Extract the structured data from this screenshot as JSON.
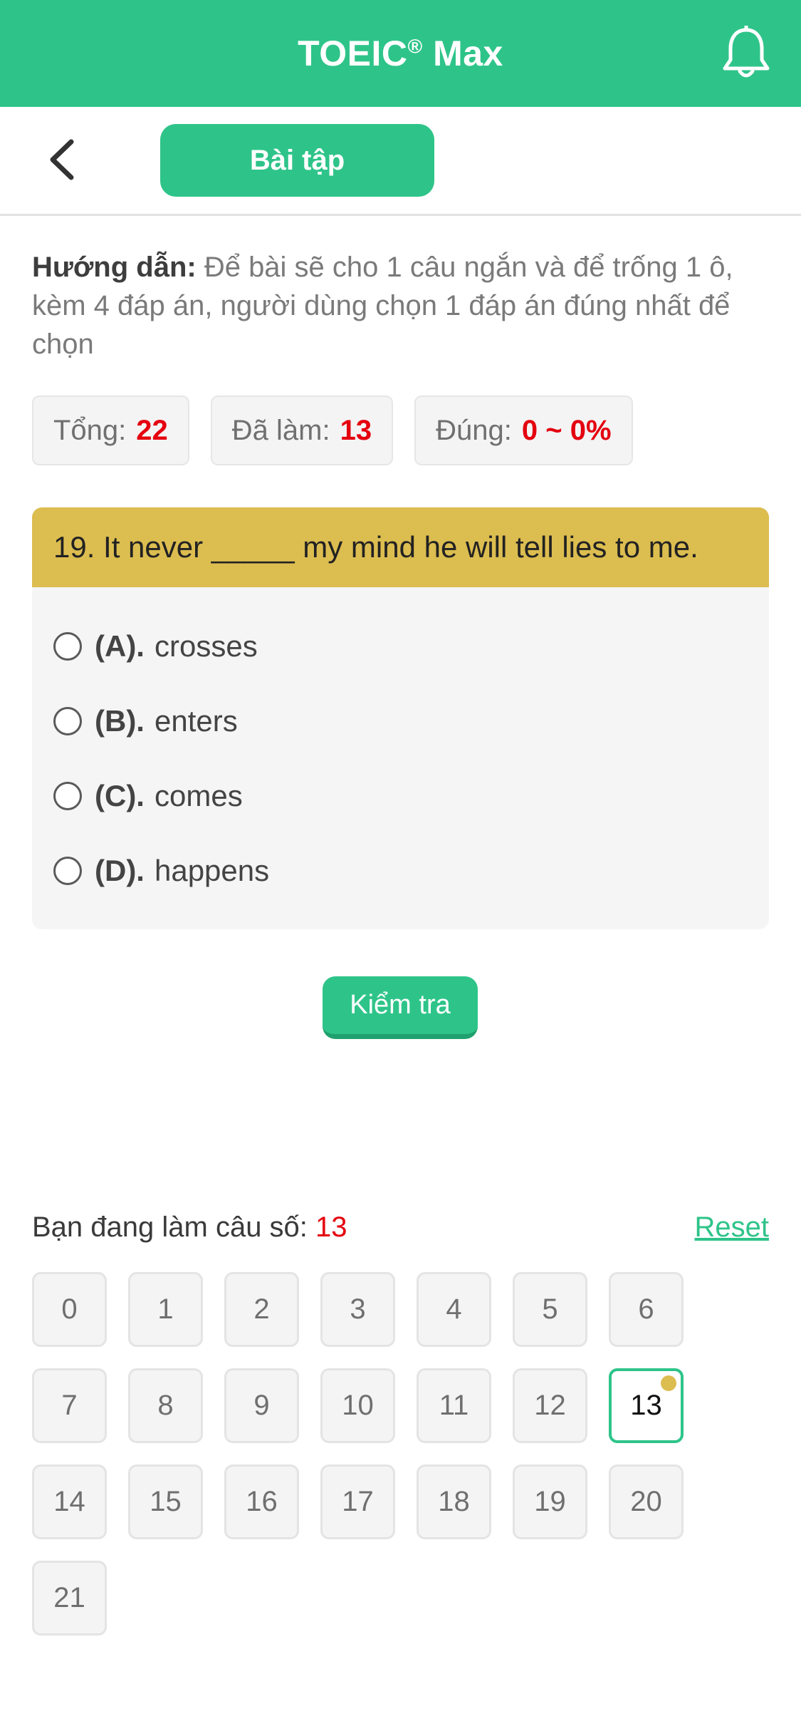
{
  "header": {
    "title": "TOEIC",
    "title_sup": "®",
    "title_suffix": " Max",
    "bell_icon": "bell-icon"
  },
  "subbar": {
    "back_icon": "chevron-left-icon",
    "tab_label": "Bài tập"
  },
  "guide": {
    "label": "Hướng dẫn:",
    "text": " Để bài sẽ cho 1 câu ngắn và để trống 1 ô, kèm 4 đáp án, người dùng chọn 1 đáp án đúng nhất để chọn"
  },
  "stats": {
    "total_label": "Tổng:",
    "total_value": "22",
    "done_label": "Đã làm:",
    "done_value": "13",
    "correct_label": "Đúng:",
    "correct_value": "0 ~ 0%"
  },
  "question": {
    "text": "19. It never _____ my mind he will tell lies to me.",
    "options": [
      {
        "label": "(A).",
        "text": "crosses"
      },
      {
        "label": "(B).",
        "text": "enters"
      },
      {
        "label": "(C).",
        "text": "comes"
      },
      {
        "label": "(D).",
        "text": "happens"
      }
    ]
  },
  "check_button": "Kiểm tra",
  "progress": {
    "label": "Bạn đang làm câu số:",
    "current": "13",
    "reset_label": "Reset"
  },
  "numbers": [
    "0",
    "1",
    "2",
    "3",
    "4",
    "5",
    "6",
    "7",
    "8",
    "9",
    "10",
    "11",
    "12",
    "13",
    "14",
    "15",
    "16",
    "17",
    "18",
    "19",
    "20",
    "21"
  ],
  "active_number": "13",
  "colors": {
    "primary": "#2ec489",
    "question_header": "#dcbd50",
    "accent_red": "#e4000f"
  }
}
